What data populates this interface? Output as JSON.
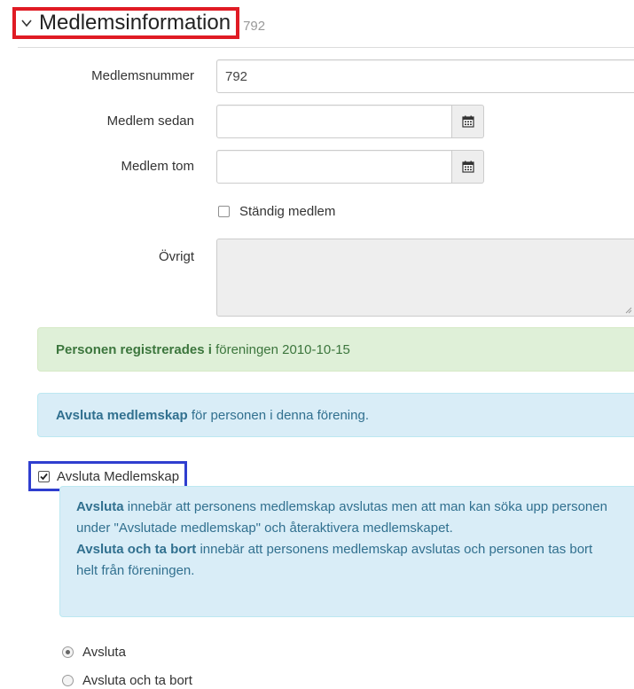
{
  "header": {
    "title": "Medlemsinformation",
    "member_number_hint": "792"
  },
  "form": {
    "member_number": {
      "label": "Medlemsnummer",
      "value": "792"
    },
    "member_since": {
      "label": "Medlem sedan",
      "value": ""
    },
    "member_until": {
      "label": "Medlem tom",
      "value": ""
    },
    "permanent": {
      "label": "Ständig medlem",
      "checked": false
    },
    "other": {
      "label": "Övrigt",
      "value": ""
    }
  },
  "alerts": {
    "registered": {
      "strong": "Personen registrerades i",
      "rest": " föreningen 2010-10-15"
    },
    "end": {
      "strong": "Avsluta medlemskap",
      "rest": " för personen i denna förening."
    }
  },
  "end_membership": {
    "label": "Avsluta Medlemskap",
    "checked": true,
    "info": {
      "p1_strong": "Avsluta",
      "p1_rest": " innebär att personens medlemskap avslutas men att man kan söka upp personen under \"Avslutade medlemskap\" och återaktivera medlemskapet.",
      "p2_strong": "Avsluta och ta bort",
      "p2_rest": " innebär att personens medlemskap avslutas och personen tas bort helt från föreningen."
    },
    "options": [
      {
        "label": "Avsluta",
        "selected": true
      },
      {
        "label": "Avsluta och ta bort",
        "selected": false
      }
    ]
  },
  "icons": {
    "collapse": "chevron-down-icon",
    "calendar": "calendar-icon"
  },
  "colors": {
    "highlight_red": "#e01b24",
    "highlight_blue": "#2f3ecf",
    "success_bg": "#dff0d8",
    "info_bg": "#d9edf7"
  }
}
